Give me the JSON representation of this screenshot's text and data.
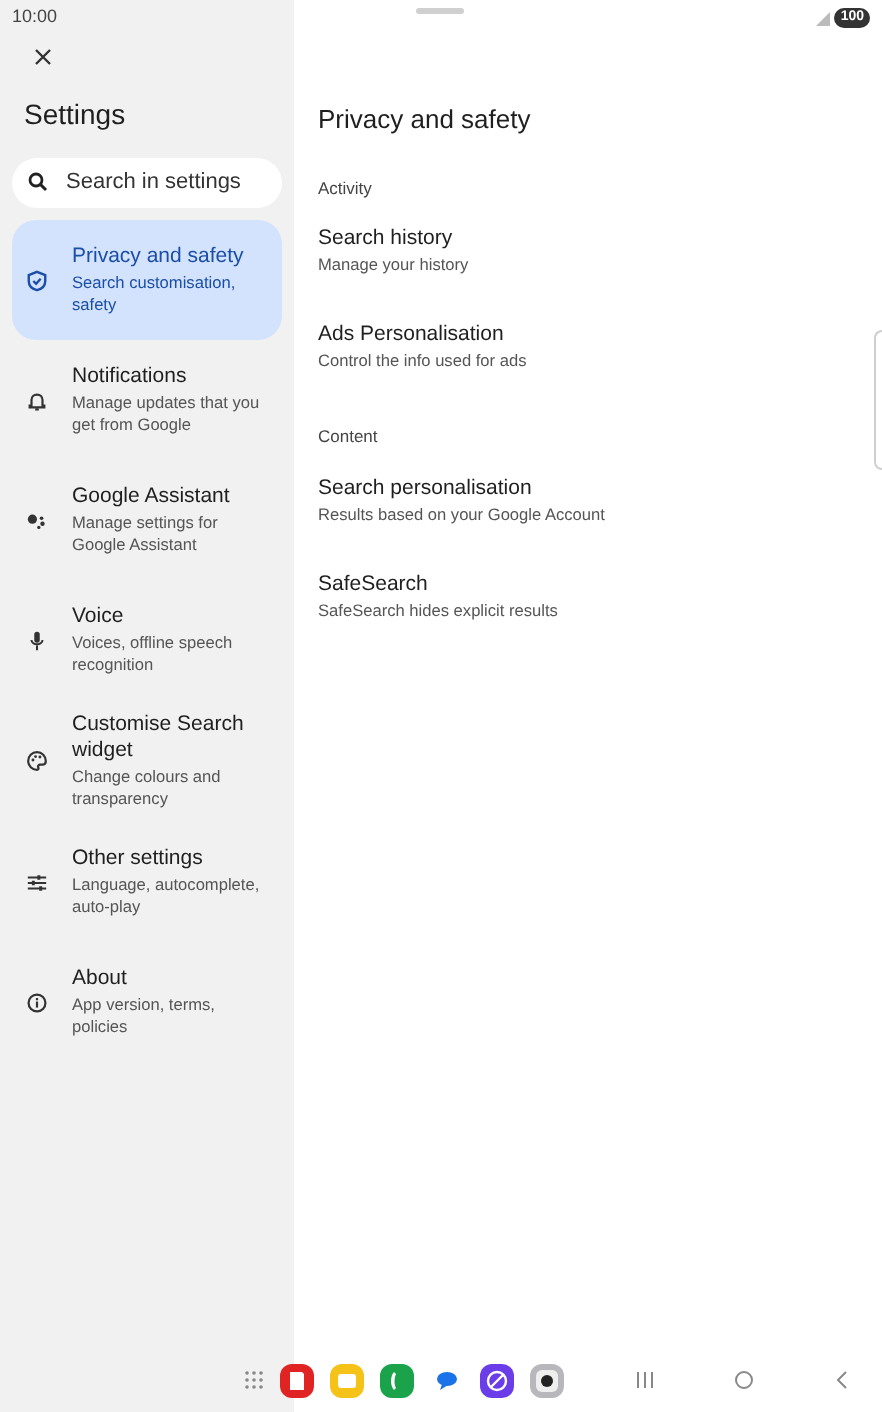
{
  "status_bar": {
    "time": "10:00",
    "battery": "100"
  },
  "sidebar": {
    "title": "Settings",
    "search": {
      "placeholder": "Search in settings"
    },
    "items": [
      {
        "title": "Privacy and safety",
        "subtitle": "Search customisation, safety",
        "selected": true
      },
      {
        "title": "Notifications",
        "subtitle": "Manage updates that you get from Google",
        "selected": false
      },
      {
        "title": "Google Assistant",
        "subtitle": "Manage settings for Google Assistant",
        "selected": false
      },
      {
        "title": "Voice",
        "subtitle": "Voices, offline speech recognition",
        "selected": false
      },
      {
        "title": "Customise Search widget",
        "subtitle": "Change colours and transparency",
        "selected": false
      },
      {
        "title": "Other settings",
        "subtitle": "Language, autocomplete, auto-play",
        "selected": false
      },
      {
        "title": "About",
        "subtitle": "App version, terms, policies",
        "selected": false
      }
    ]
  },
  "detail": {
    "title": "Privacy and safety",
    "sections": [
      {
        "header": "Activity",
        "items": [
          {
            "title": "Search history",
            "subtitle": "Manage your history"
          },
          {
            "title": "Ads Personalisation",
            "subtitle": "Control the info used for ads"
          }
        ]
      },
      {
        "header": "Content",
        "items": [
          {
            "title": "Search personalisation",
            "subtitle": "Results based on your Google Account"
          },
          {
            "title": "SafeSearch",
            "subtitle": "SafeSearch hides explicit results"
          }
        ]
      }
    ]
  }
}
